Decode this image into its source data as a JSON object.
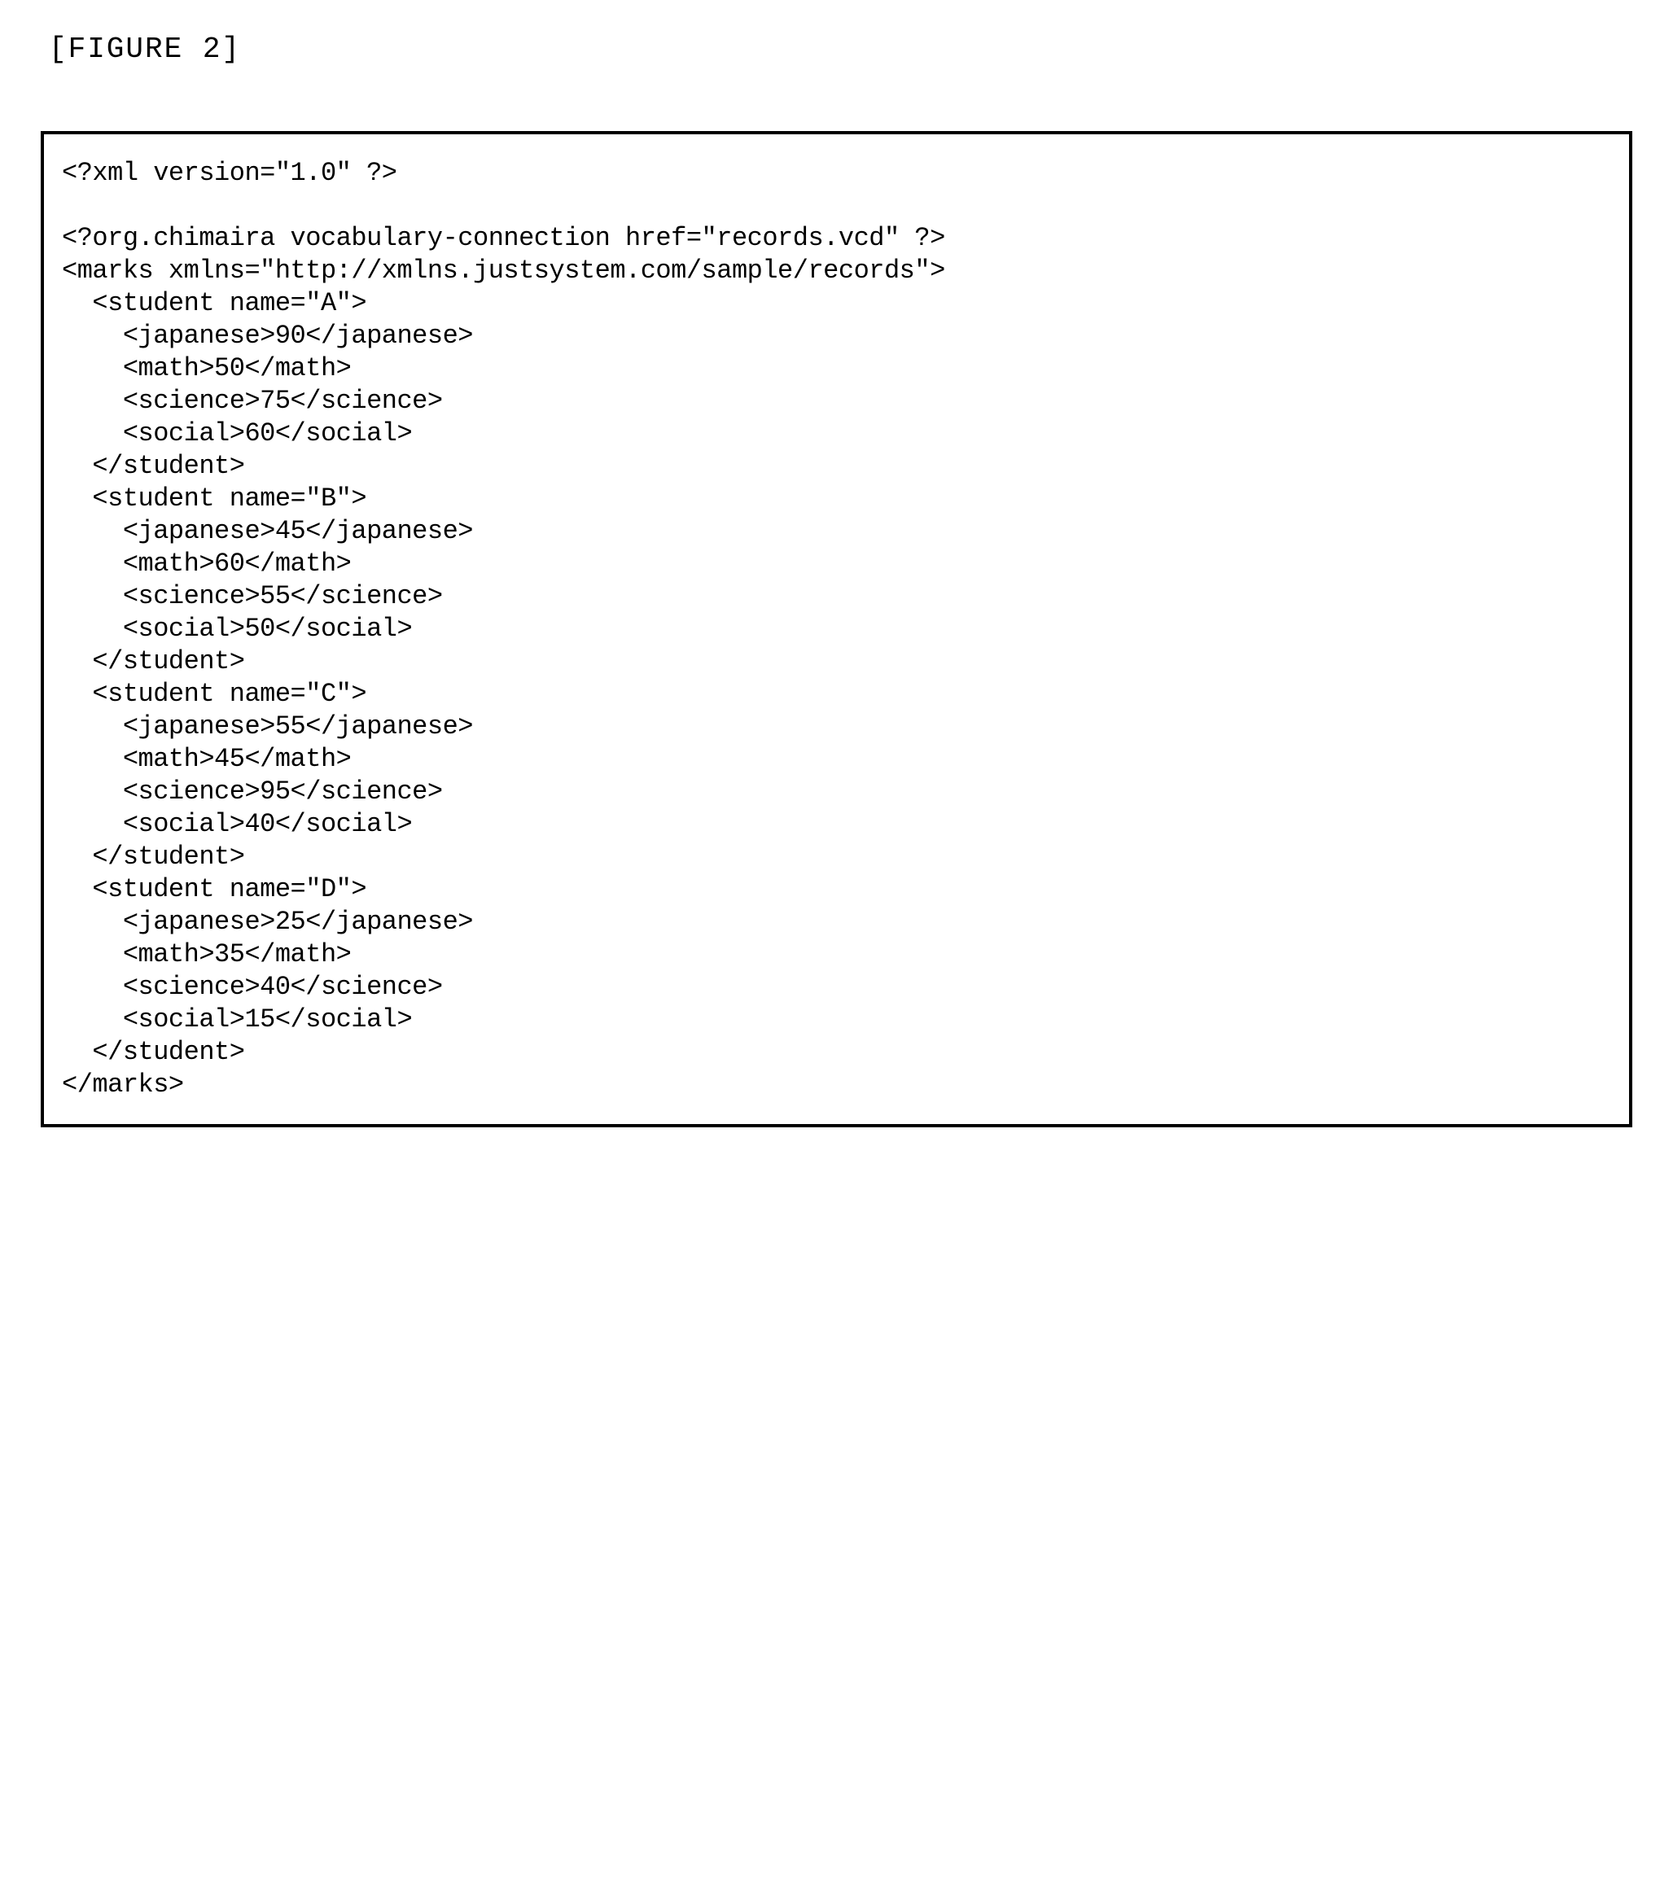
{
  "figure_label": "[FIGURE 2]",
  "xml": {
    "declaration": "<?xml version=\"1.0\" ?>",
    "processing_instruction": "<?org.chimaira vocabulary-connection href=\"records.vcd\" ?>",
    "root_open": "<marks xmlns=\"http://xmlns.justsystem.com/sample/records\">",
    "root_close": "</marks>",
    "students": [
      {
        "open": "  <student name=\"A\">",
        "japanese": "    <japanese>90</japanese>",
        "math": "    <math>50</math>",
        "science": "    <science>75</science>",
        "social": "    <social>60</social>",
        "close": "  </student>"
      },
      {
        "open": "  <student name=\"B\">",
        "japanese": "    <japanese>45</japanese>",
        "math": "    <math>60</math>",
        "science": "    <science>55</science>",
        "social": "    <social>50</social>",
        "close": "  </student>"
      },
      {
        "open": "  <student name=\"C\">",
        "japanese": "    <japanese>55</japanese>",
        "math": "    <math>45</math>",
        "science": "    <science>95</science>",
        "social": "    <social>40</social>",
        "close": "  </student>"
      },
      {
        "open": "  <student name=\"D\">",
        "japanese": "    <japanese>25</japanese>",
        "math": "    <math>35</math>",
        "science": "    <science>40</science>",
        "social": "    <social>15</social>",
        "close": "  </student>"
      }
    ]
  }
}
